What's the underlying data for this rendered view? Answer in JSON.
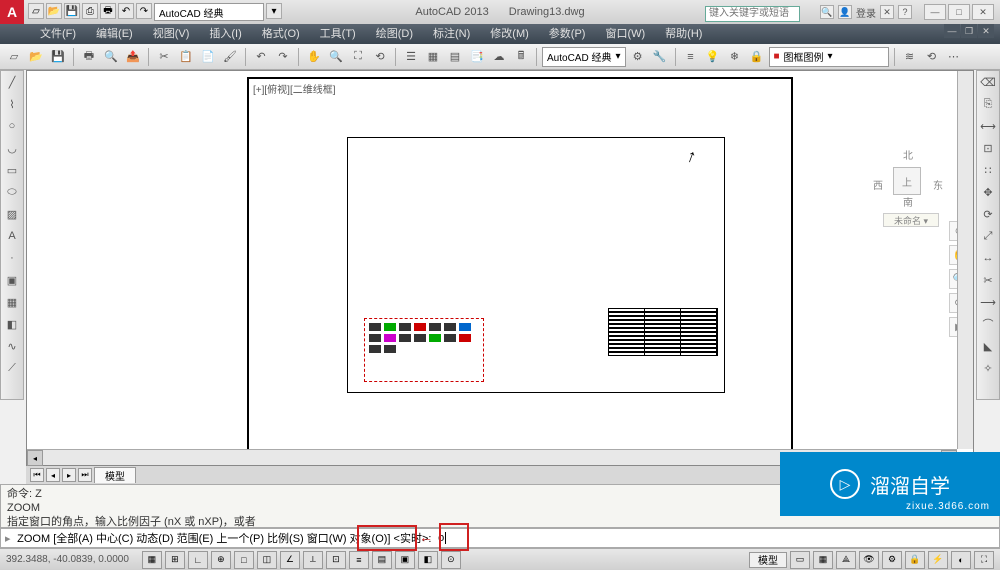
{
  "title": {
    "app": "AutoCAD 2013",
    "doc": "Drawing13.dwg"
  },
  "qat_search": "AutoCAD 经典",
  "title_search_placeholder": "键入关键字或短语",
  "login_label": "登录",
  "menus": [
    "文件(F)",
    "编辑(E)",
    "视图(V)",
    "插入(I)",
    "格式(O)",
    "工具(T)",
    "绘图(D)",
    "标注(N)",
    "修改(M)",
    "参数(P)",
    "窗口(W)",
    "帮助(H)"
  ],
  "workspace_drop": "AutoCAD 经典",
  "layer_drop": "图框图例",
  "viewport_label": "[+][俯视][二维线框]",
  "viewcube": {
    "n": "北",
    "s": "南",
    "e": "东",
    "w": "西",
    "top": "上",
    "cmd": "未命名 ▾"
  },
  "tabs": {
    "model": "模型"
  },
  "cmd": {
    "l1": "命令: Z",
    "l2": "ZOOM",
    "l3": "指定窗口的角点，输入比例因子 (nX 或 nXP)，或者",
    "prompt": "ZOOM [全部(A) 中心(C) 动态(D) 范围(E) 上一个(P) 比例(S) 窗口(W) 对象(O)] <实时>:",
    "input": "o",
    "opt_highlight": "对象(O)",
    "prompt_tail": "<实时>:"
  },
  "status": {
    "coords": "392.3488, -40.0839, 0.0000",
    "model_tab": "模型"
  },
  "watermark": {
    "main": "溜溜自学",
    "sub": "zixue.3d66.com"
  }
}
